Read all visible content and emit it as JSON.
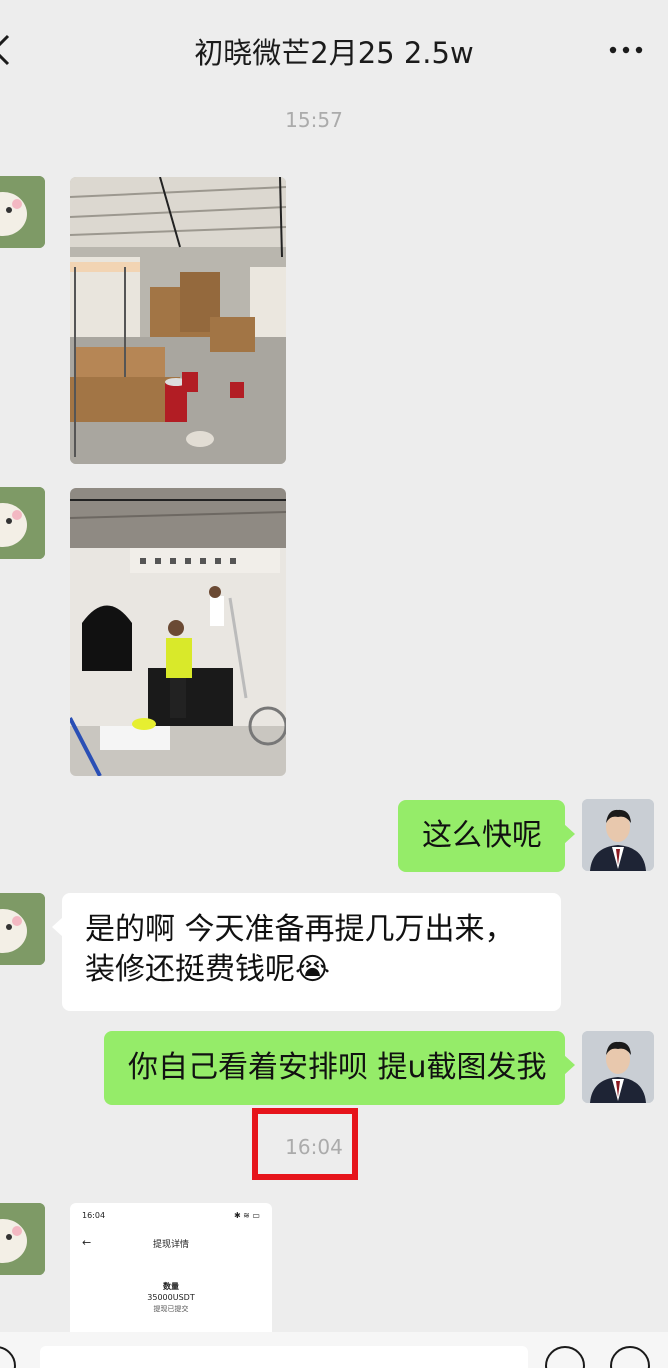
{
  "header": {
    "title": "初晓微芒2月25 2.5w",
    "back_icon": "chevron-left-icon",
    "more_icon": "more-horizontal-icon"
  },
  "timestamps": {
    "first": "15:57",
    "second": "16:04"
  },
  "messages": {
    "m1": {
      "sender": "contact",
      "type": "image",
      "subject": "renovation site with cardboard boxes and paint cans"
    },
    "m2": {
      "sender": "contact",
      "type": "image",
      "subject": "workers painting store interior with arched window"
    },
    "m3": {
      "sender": "me",
      "type": "text",
      "text": "这么快呢"
    },
    "m4": {
      "sender": "contact",
      "type": "text",
      "line1": "是的啊 今天准备再提几万出来，",
      "line2": "装修还挺费钱呢",
      "emoji": "😭"
    },
    "m5": {
      "sender": "me",
      "type": "text",
      "text": "你自己看着安排呗 提u截图发我"
    },
    "m6": {
      "sender": "contact",
      "type": "image",
      "screenshot": {
        "time": "16:04",
        "status": "✱ ≋ ▭",
        "back": "←",
        "title": "提现详情",
        "label": "数量",
        "amount": "35000USDT",
        "note": "提现已提交"
      }
    }
  },
  "colors": {
    "background": "#ededed",
    "my_bubble": "#95ec69",
    "their_bubble": "#ffffff",
    "highlight_box": "#e6141b",
    "timestamp_text": "#ababab"
  },
  "input_bar": {
    "voice_icon": "voice-icon",
    "emoji_icon": "emoji-icon",
    "plus_icon": "plus-icon"
  }
}
